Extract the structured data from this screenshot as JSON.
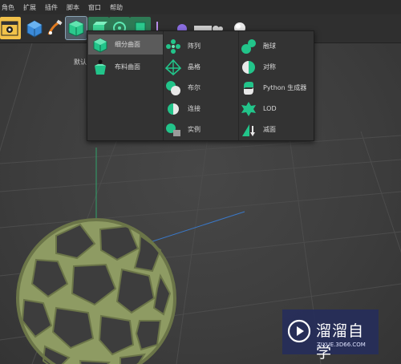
{
  "menubar": {
    "items": [
      "角色",
      "扩展",
      "插件",
      "脚本",
      "窗口",
      "帮助"
    ]
  },
  "toolbar": {
    "buttons": [
      "render-settings-icon",
      "cube-icon",
      "pen-icon",
      "subdivision-surface-icon",
      "generator-icon",
      "deformer-icon",
      "object-icon",
      "floor-icon",
      "scene-icon",
      "camera-icon",
      "light-icon"
    ]
  },
  "viewport": {
    "label": "默认"
  },
  "dropdown": {
    "column1": [
      {
        "label": "细分曲面",
        "icon": "subdivision-surface-icon",
        "highlighted": true
      },
      {
        "label": "布料曲面",
        "icon": "cloth-surface-icon",
        "highlighted": false
      }
    ],
    "column2": [
      {
        "label": "阵列",
        "icon": "array-icon"
      },
      {
        "label": "晶格",
        "icon": "atom-array-icon"
      },
      {
        "label": "布尔",
        "icon": "boolean-icon"
      },
      {
        "label": "连接",
        "icon": "connect-icon"
      },
      {
        "label": "实例",
        "icon": "instance-icon"
      }
    ],
    "column3": [
      {
        "label": "融球",
        "icon": "metaball-icon"
      },
      {
        "label": "对称",
        "icon": "symmetry-icon"
      },
      {
        "label": "Python 生成器",
        "icon": "python-generator-icon"
      },
      {
        "label": "LOD",
        "icon": "lod-icon"
      },
      {
        "label": "减面",
        "icon": "polygon-reduction-icon"
      }
    ]
  },
  "watermark": {
    "title": "溜溜自学",
    "url": "ZIXUE.3D66.COM"
  },
  "colors": {
    "accent_green": "#22c48a",
    "object_green": "#8e9b63",
    "menu_bg": "#333333",
    "highlight": "#5b5b5b"
  }
}
